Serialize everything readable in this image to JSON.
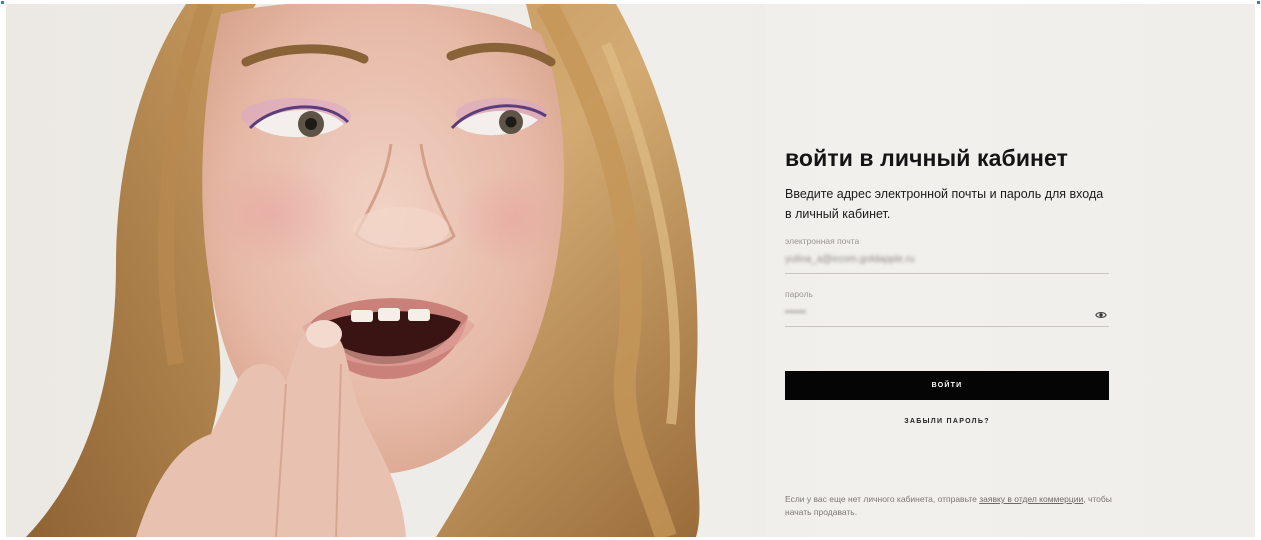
{
  "login": {
    "title": "войти в личный кабинет",
    "subtitle": "Введите адрес электронной почты и пароль для входа в личный кабинет.",
    "email_label": "электронная почта",
    "email_value": "yulina_a@ecom.goldapple.ru",
    "password_label": "пароль",
    "password_value": "••••••",
    "show_password_icon": "eye-icon",
    "submit_label": "войти",
    "forgot_label": "забыли пароль?"
  },
  "footer": {
    "text_before": "Если у вас еще нет личного кабинета, отправьте ",
    "link_label": "заявку в отдел коммерции",
    "text_after": ", чтобы начать продавать."
  },
  "colors": {
    "button_bg": "#050505",
    "button_text": "#ffffff",
    "page_bg": "#efede9"
  }
}
